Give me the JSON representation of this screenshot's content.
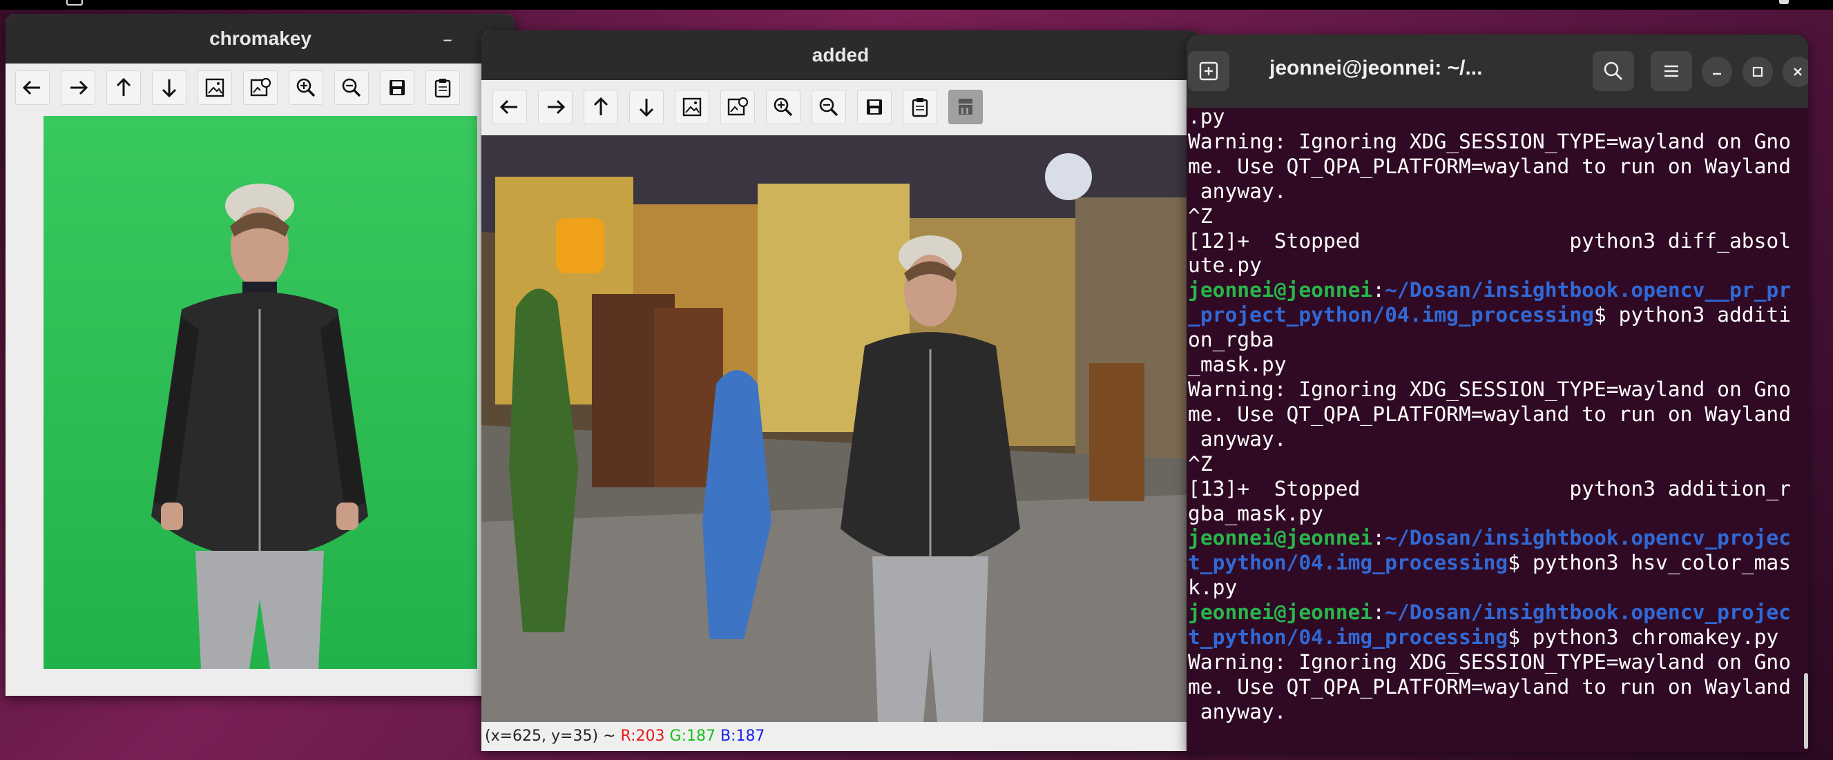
{
  "windows": {
    "chromakey": {
      "title": "chromakey",
      "minimize_symbol": "–",
      "toolbar_icons": [
        "arrow-left-icon",
        "arrow-right-icon",
        "arrow-up-icon",
        "arrow-down-icon",
        "image-icon",
        "image-settings-icon",
        "zoom-in-icon",
        "zoom-out-icon",
        "save-icon",
        "clipboard-icon"
      ]
    },
    "added": {
      "title": "added",
      "toolbar_icons": [
        "arrow-left-icon",
        "arrow-right-icon",
        "arrow-up-icon",
        "arrow-down-icon",
        "image-icon",
        "image-settings-icon",
        "zoom-in-icon",
        "zoom-out-icon",
        "save-icon",
        "clipboard-icon",
        "properties-icon"
      ],
      "status": {
        "coords": "(x=625, y=35) ~ ",
        "r": "R:203",
        "g": "G:187",
        "b": "B:187"
      }
    },
    "terminal": {
      "title": "jeonnei@jeonnei: ~/...",
      "buttons": [
        "new-tab-icon",
        "search-icon",
        "menu-icon",
        "minimize-icon",
        "maximize-icon",
        "close-icon"
      ],
      "lines": [
        [
          {
            "t": ".py",
            "c": "w"
          }
        ],
        [
          {
            "t": "Warning: Ignoring XDG_SESSION_TYPE=wayland on Gno",
            "c": "w"
          }
        ],
        [
          {
            "t": "me. Use QT_QPA_PLATFORM=wayland to run on Wayland",
            "c": "w"
          }
        ],
        [
          {
            "t": " anyway.",
            "c": "w"
          }
        ],
        [
          {
            "t": "^Z",
            "c": "w"
          }
        ],
        [
          {
            "t": "[12]+  Stopped                 python3 diff_absol",
            "c": "w"
          }
        ],
        [
          {
            "t": "ute.py",
            "c": "w"
          }
        ],
        [
          {
            "t": "jeonnei@jeonnei",
            "c": "u"
          },
          {
            "t": ":",
            "c": "w"
          },
          {
            "t": "~/Dosan/insightbook.opencv__pr_pr",
            "c": "p"
          }
        ],
        [
          {
            "t": "_project_python/04.img_processing",
            "c": "p"
          },
          {
            "t": "$ python3 additi",
            "c": "w"
          }
        ],
        [
          {
            "t": "on_rgba",
            "c": "w"
          }
        ],
        [
          {
            "t": "_mask.py",
            "c": "w"
          }
        ],
        [
          {
            "t": "Warning: Ignoring XDG_SESSION_TYPE=wayland on Gno",
            "c": "w"
          }
        ],
        [
          {
            "t": "me. Use QT_QPA_PLATFORM=wayland to run on Wayland",
            "c": "w"
          }
        ],
        [
          {
            "t": " anyway.",
            "c": "w"
          }
        ],
        [
          {
            "t": "^Z",
            "c": "w"
          }
        ],
        [
          {
            "t": "[13]+  Stopped                 python3 addition_r",
            "c": "w"
          }
        ],
        [
          {
            "t": "gba_mask.py",
            "c": "w"
          }
        ],
        [
          {
            "t": "jeonnei@jeonnei",
            "c": "u"
          },
          {
            "t": ":",
            "c": "w"
          },
          {
            "t": "~/Dosan/insightbook.opencv_projec",
            "c": "p"
          }
        ],
        [
          {
            "t": "t_python/04.img_processing",
            "c": "p"
          },
          {
            "t": "$ python3 hsv_color_mas",
            "c": "w"
          }
        ],
        [
          {
            "t": "k.py",
            "c": "w"
          }
        ],
        [
          {
            "t": "jeonnei@jeonnei",
            "c": "u"
          },
          {
            "t": ":",
            "c": "w"
          },
          {
            "t": "~/Dosan/insightbook.opencv_projec",
            "c": "p"
          }
        ],
        [
          {
            "t": "t_python/04.img_processing",
            "c": "p"
          },
          {
            "t": "$ python3 chromakey.py",
            "c": "w"
          }
        ],
        [
          {
            "t": "Warning: Ignoring XDG_SESSION_TYPE=wayland on Gno",
            "c": "w"
          }
        ],
        [
          {
            "t": "me. Use QT_QPA_PLATFORM=wayland to run on Wayland",
            "c": "w"
          }
        ],
        [
          {
            "t": " anyway.",
            "c": "w"
          }
        ]
      ]
    }
  },
  "colors": {
    "terminal_bg": "#300a24",
    "prompt_user": "#27b64a",
    "prompt_path": "#3069d6",
    "chroma_green": "#2fbd55"
  }
}
